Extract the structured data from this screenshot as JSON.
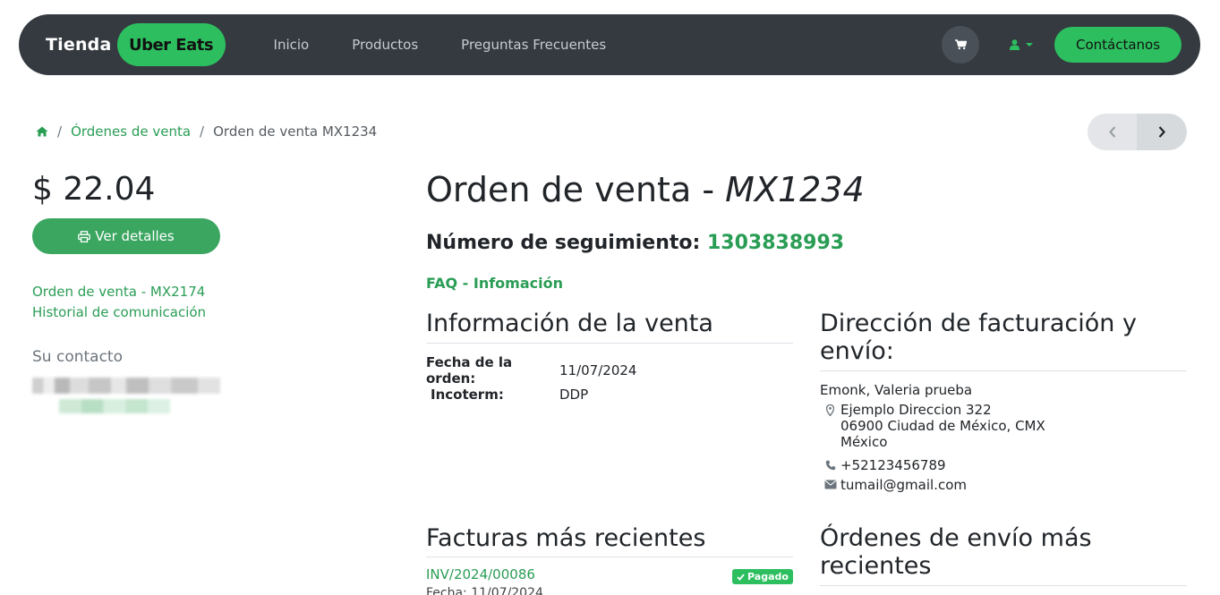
{
  "navbar": {
    "brand_text": "Tienda",
    "brand_pill": "Uber Eats",
    "links": [
      "Inicio",
      "Productos",
      "Preguntas Frecuentes"
    ],
    "cart_icon": "cart-icon",
    "user_icon": "user-icon",
    "contact_label": "Contáctanos",
    "accent_color": "#2dbf5f",
    "bg_color": "#343a40"
  },
  "breadcrumb": {
    "home_icon": "home-icon",
    "sep": "/",
    "parent": "Órdenes de venta",
    "current": "Orden de venta MX1234"
  },
  "sidebar": {
    "amount": "$ 22.04",
    "details_label": "Ver detalles",
    "links": [
      "Orden de venta - MX2174",
      "Historial de comunicación"
    ],
    "contact_title": "Su contacto"
  },
  "order": {
    "title_prefix": "Orden de venta - ",
    "title_ref": "MX1234",
    "tracking_label": "Número de seguimiento: ",
    "tracking_number": "1303838993",
    "faq_link": "FAQ - Infomación"
  },
  "sale_info": {
    "heading": "Información de la venta",
    "rows": [
      {
        "label": "Fecha de la orden:",
        "value": "11/07/2024"
      },
      {
        "label": "Incoterm:",
        "value": "DDP"
      }
    ]
  },
  "billing": {
    "heading_line1": "Dirección de facturación y",
    "heading_line2": "envío:",
    "name": "Emonk, Valeria prueba",
    "address_lines": [
      "Ejemplo Direccion 322",
      "06900 Ciudad de México, CMX",
      "México"
    ],
    "phone": "+52123456789",
    "email": "tumail@gmail.com"
  },
  "invoices": {
    "heading": "Facturas más recientes",
    "items": [
      {
        "number": "INV/2024/00086",
        "status": "Pagado",
        "date": "Fecha: 11/07/2024"
      }
    ]
  },
  "shipments": {
    "heading_line1": "Órdenes de envío más",
    "heading_line2": "recientes"
  }
}
